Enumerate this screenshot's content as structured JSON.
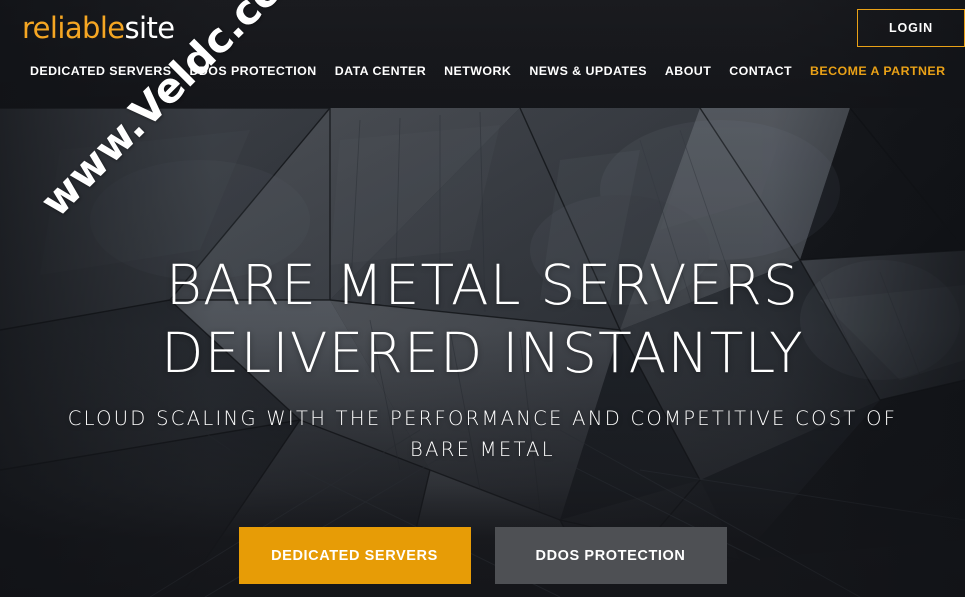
{
  "site": {
    "logo_primary": "reliable",
    "logo_secondary": "site",
    "brand_orange": "#e9a117",
    "cta_orange": "#e79c06",
    "cta_gray": "#4e5054",
    "page_bg": "#17181b"
  },
  "header": {
    "login_label": "LOGIN",
    "nav": [
      {
        "label": "DEDICATED SERVERS",
        "accent": false
      },
      {
        "label": "DDOS PROTECTION",
        "accent": false
      },
      {
        "label": "DATA CENTER",
        "accent": false
      },
      {
        "label": "NETWORK",
        "accent": false
      },
      {
        "label": "NEWS & UPDATES",
        "accent": false
      },
      {
        "label": "ABOUT",
        "accent": false
      },
      {
        "label": "CONTACT",
        "accent": false
      },
      {
        "label": "BECOME A PARTNER",
        "accent": true
      }
    ]
  },
  "hero": {
    "headline_line1": "BARE METAL SERVERS",
    "headline_line2": "DELIVERED INSTANTLY",
    "subtitle": "CLOUD SCALING WITH THE PERFORMANCE AND COMPETITIVE COST OF BARE METAL",
    "cta_primary": "DEDICATED SERVERS",
    "cta_secondary": "DDOS PROTECTION"
  },
  "watermark": {
    "text": "www.Veldc.com"
  }
}
